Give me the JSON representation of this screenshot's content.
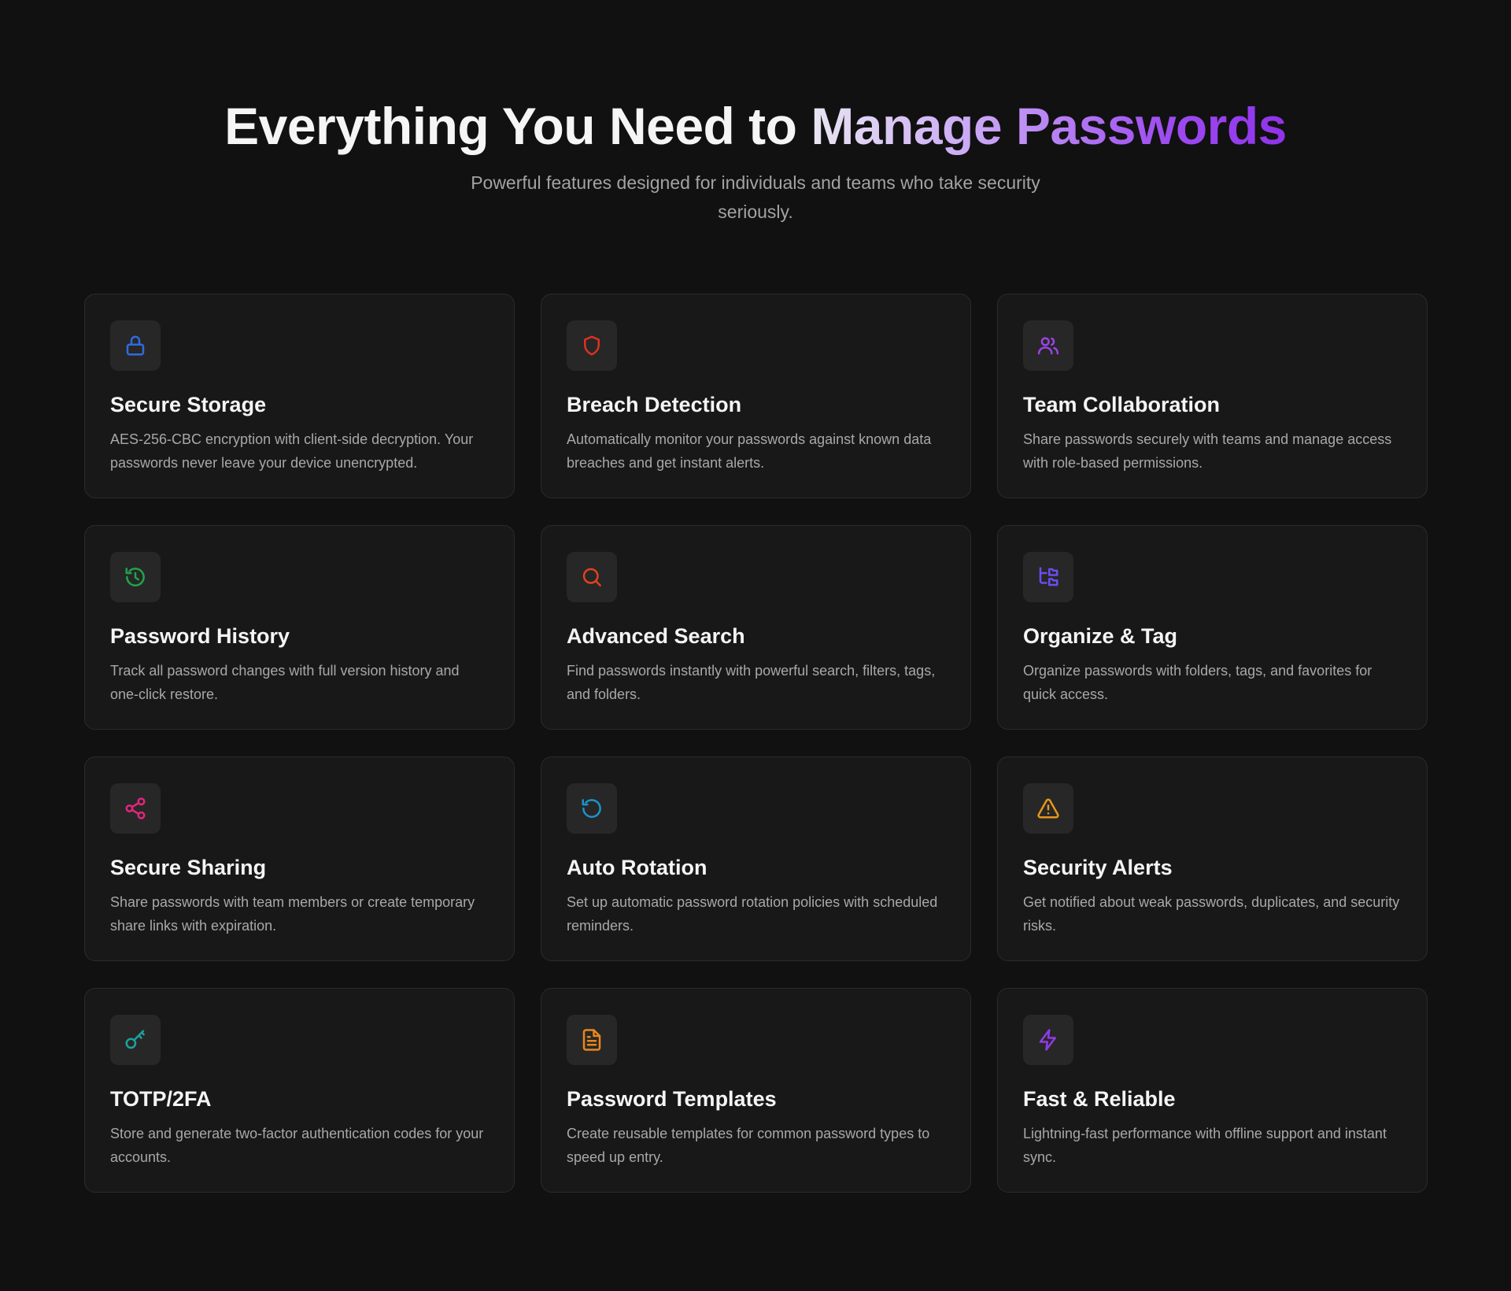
{
  "header": {
    "title_main": "Everything You Need to",
    "title_accent": "Manage Passwords",
    "subtitle": "Powerful features designed for individuals and teams who take security seriously."
  },
  "features": [
    {
      "title": "Secure Storage",
      "description": "AES-256-CBC encryption with client-side decryption. Your passwords never leave your device unencrypted.",
      "icon": "lock-icon",
      "color": "#2f6bdf"
    },
    {
      "title": "Breach Detection",
      "description": "Automatically monitor your passwords against known data breaches and get instant alerts.",
      "icon": "shield-icon",
      "color": "#e0321f"
    },
    {
      "title": "Team Collaboration",
      "description": "Share passwords securely with teams and manage access with role-based permissions.",
      "icon": "users-icon",
      "color": "#9b43e6"
    },
    {
      "title": "Password History",
      "description": "Track all password changes with full version history and one-click restore.",
      "icon": "history-icon",
      "color": "#20a44a"
    },
    {
      "title": "Advanced Search",
      "description": "Find passwords instantly with powerful search, filters, tags, and folders.",
      "icon": "search-icon",
      "color": "#e0421f"
    },
    {
      "title": "Organize & Tag",
      "description": "Organize passwords with folders, tags, and favorites for quick access.",
      "icon": "folder-tree-icon",
      "color": "#6d4cf0"
    },
    {
      "title": "Secure Sharing",
      "description": "Share passwords with team members or create temporary share links with expiration.",
      "icon": "share-icon",
      "color": "#e3267a"
    },
    {
      "title": "Auto Rotation",
      "description": "Set up automatic password rotation policies with scheduled reminders.",
      "icon": "rotate-icon",
      "color": "#1e92c9"
    },
    {
      "title": "Security Alerts",
      "description": "Get notified about weak passwords, duplicates, and security risks.",
      "icon": "alert-triangle-icon",
      "color": "#e6961c"
    },
    {
      "title": "TOTP/2FA",
      "description": "Store and generate two-factor authentication codes for your accounts.",
      "icon": "key-icon",
      "color": "#1ba39a"
    },
    {
      "title": "Password Templates",
      "description": "Create reusable templates for common password types to speed up entry.",
      "icon": "file-text-icon",
      "color": "#ea861c"
    },
    {
      "title": "Fast & Reliable",
      "description": "Lightning-fast performance with offline support and instant sync.",
      "icon": "zap-icon",
      "color": "#8f3ae8"
    }
  ]
}
